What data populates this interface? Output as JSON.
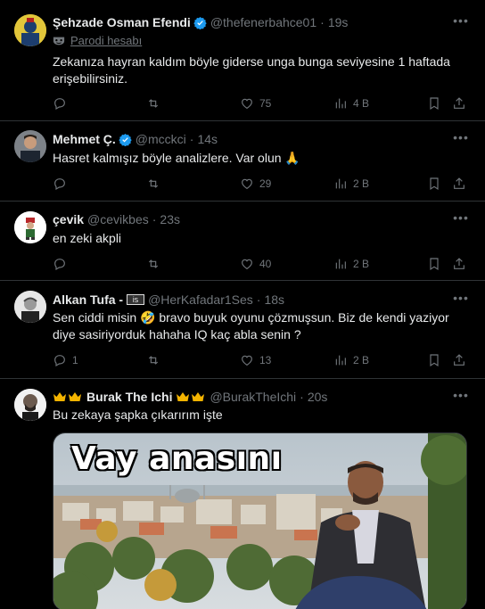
{
  "tweets": [
    {
      "name": "Şehzade Osman Efendi",
      "handle": "@thefenerbahce01",
      "time": "19s",
      "parody_label": "Parodi hesabı",
      "text": "Zekanıza hayran kaldım böyle giderse unga bunga seviyesine 1 haftada erişebilirsiniz.",
      "replies": "",
      "reposts": "",
      "likes": "75",
      "views": "4 B"
    },
    {
      "name": "Mehmet Ç.",
      "handle": "@mcckci",
      "time": "14s",
      "text": "Hasret kalmışız böyle analizlere. Var olun 🙏",
      "replies": "",
      "reposts": "",
      "likes": "29",
      "views": "2 B"
    },
    {
      "name": "çevik",
      "handle": "@cevikbes",
      "time": "23s",
      "text": "en zeki akpli",
      "replies": "",
      "reposts": "",
      "likes": "40",
      "views": "2 B"
    },
    {
      "name": "Alkan Tufa -",
      "handle": "@HerKafadar1Ses",
      "time": "18s",
      "text": "Sen ciddi misin 🤣 bravo buyuk oyunu çözmuşsun. Biz de kendi yaziyor diye sasiriyorduk hahaha IQ kaç abla senin ?",
      "replies": "1",
      "reposts": "",
      "likes": "13",
      "views": "2 B"
    },
    {
      "name": "Burak The Ichi",
      "handle": "@BurakTheIchi",
      "time": "20s",
      "text": "Bu zekaya şapka çıkarırım işte",
      "media_caption": "Vay anasını"
    }
  ],
  "colors": {
    "background": "#000000",
    "text": "#e7e9ea",
    "muted": "#71767b",
    "verified": "#1d9bf0",
    "divider": "#2f3336"
  }
}
